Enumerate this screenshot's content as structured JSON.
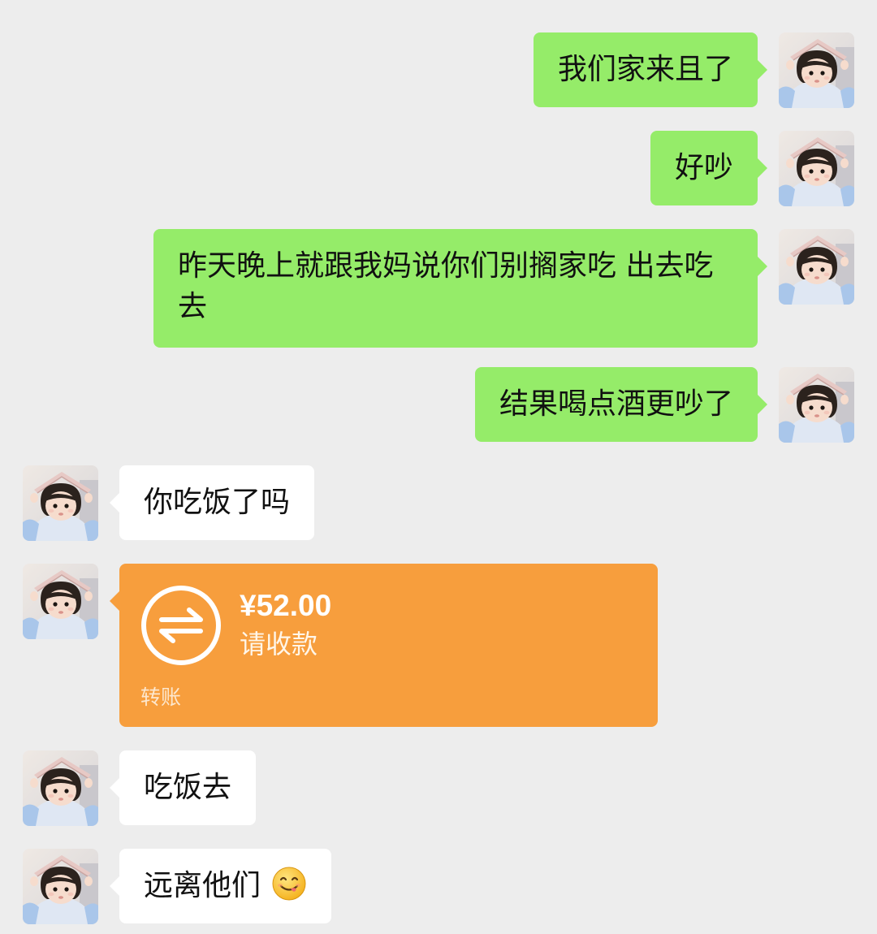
{
  "messages": [
    {
      "side": "right",
      "text": "我们家来且了"
    },
    {
      "side": "right",
      "text": "好吵"
    },
    {
      "side": "right",
      "text": "昨天晚上就跟我妈说你们别搁家吃 出去吃去"
    },
    {
      "side": "right",
      "text": "结果喝点酒更吵了"
    },
    {
      "side": "left",
      "text": "你吃饭了吗"
    },
    {
      "side": "left",
      "type": "transfer",
      "amount": "¥52.00",
      "status": "请收款",
      "label": "转账"
    },
    {
      "side": "left",
      "text": "吃饭去"
    },
    {
      "side": "left",
      "text": "远离他们",
      "emoji": "yum-face-emoji"
    }
  ],
  "colors": {
    "background": "#ededed",
    "outgoing_bubble": "#95ec69",
    "incoming_bubble": "#ffffff",
    "transfer_card": "#f79e3d"
  }
}
